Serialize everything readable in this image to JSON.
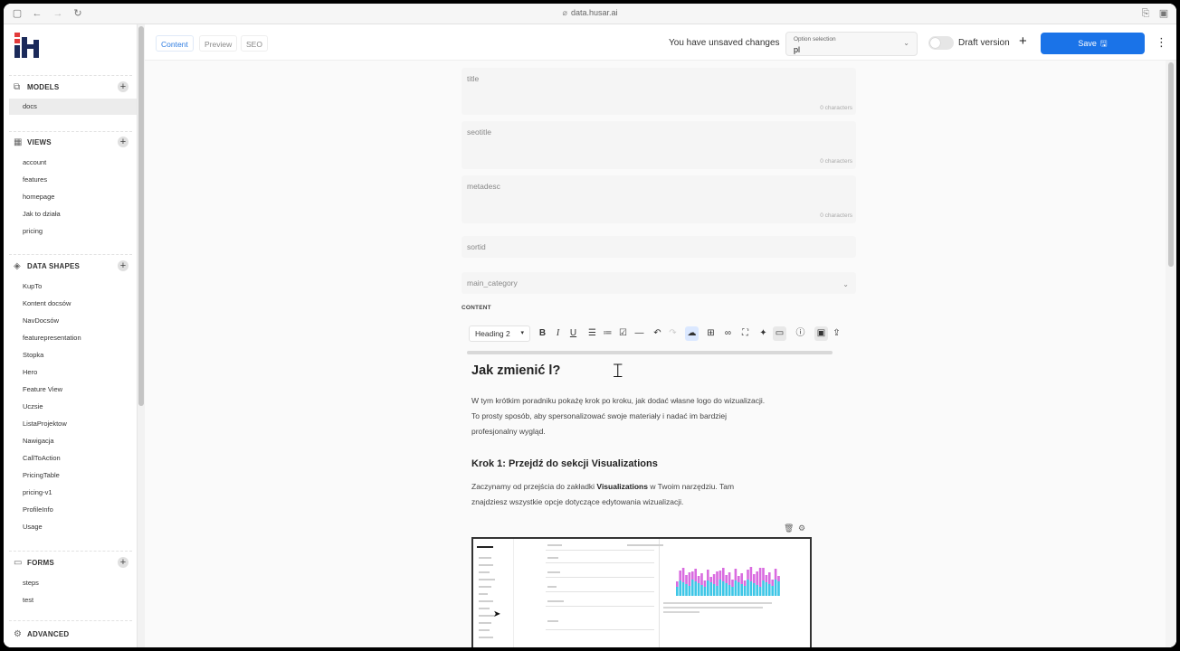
{
  "browser": {
    "url": "data.husar.ai",
    "icons": [
      "sidebar-toggle-icon",
      "back-icon",
      "forward-icon",
      "reload-icon",
      "share-icon",
      "tabs-icon"
    ]
  },
  "sidebar": {
    "sections": {
      "models": {
        "title": "MODELS",
        "items": [
          "docs"
        ]
      },
      "views": {
        "title": "VIEWS",
        "items": [
          "account",
          "features",
          "homepage",
          "Jak to działa",
          "pricing"
        ]
      },
      "data_shapes": {
        "title": "DATA SHAPES",
        "items": [
          "KupTo",
          "Kontent docsów",
          "NavDocsów",
          "featurepresentation",
          "Stopka",
          "Hero",
          "Feature View",
          "Uczsie",
          "ListaProjektow",
          "Nawigacja",
          "CallToAction",
          "PricingTable",
          "pricing-v1",
          "ProfileInfo",
          "Usage"
        ]
      },
      "forms": {
        "title": "FORMS",
        "items": [
          "steps",
          "test"
        ]
      },
      "advanced": {
        "title": "ADVANCED"
      }
    },
    "active_item": "docs"
  },
  "topbar": {
    "tabs": [
      "Content",
      "Preview",
      "SEO"
    ],
    "active_tab": "Content",
    "unsaved": "You have unsaved changes",
    "option_selection": {
      "label": "Option selection",
      "value": "pl"
    },
    "draft_label": "Draft version",
    "draft_on": false,
    "plus": "+",
    "save_label": "Save"
  },
  "form": {
    "fields": [
      {
        "label": "title",
        "counter": "0 characters"
      },
      {
        "label": "seotitle",
        "counter": "0 characters"
      },
      {
        "label": "metadesc",
        "counter": "0 characters"
      },
      {
        "label": "sortid"
      },
      {
        "label": "main_category"
      }
    ],
    "content_label": "CONTENT"
  },
  "editor": {
    "heading_select": "Heading 2",
    "tools": [
      "bold-icon",
      "italic-icon",
      "underline-icon",
      "bullet-list-icon",
      "ordered-list-icon",
      "checklist-icon",
      "horizontal-rule-icon",
      "undo-icon",
      "redo-icon",
      "upload-icon",
      "table-icon",
      "link-icon",
      "fullscreen-icon",
      "magic-icon",
      "monitor-icon",
      "info-icon",
      "image-icon",
      "export-icon"
    ],
    "tool_labels": {
      "bold": "B",
      "italic": "I",
      "underline": "U"
    }
  },
  "doc": {
    "h2": "Jak zmienić l?",
    "p1_line1": "W tym krótkim poradniku pokażę krok po kroku, jak dodać własne logo do wizualizacji.",
    "p1_line2": "To prosty sposób, aby spersonalizować swoje materiały i nadać im bardziej",
    "p1_line3": "profesjonalny wygląd.",
    "h3": "Krok 1: Przejdź do sekcji Visualizations",
    "p2_a": "Zaczynamy od przejścia do zakładki ",
    "p2_b": "Visualizations",
    "p2_c": " w Twoim narzędziu. Tam",
    "p2_line2": "znajdziesz wszystkie opcje dotyczące edytowania wizualizacji."
  },
  "colors": {
    "accent": "#1a73e8",
    "chart_pink": "#d96be0",
    "chart_blue": "#3ec6e6"
  }
}
